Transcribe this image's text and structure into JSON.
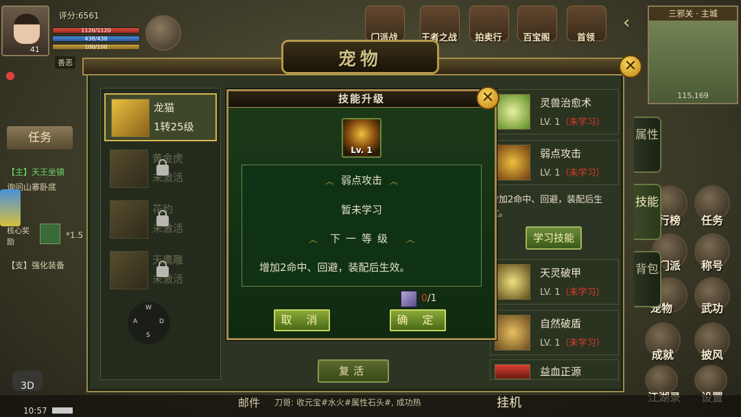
{
  "hud": {
    "score": "评分:6561",
    "level": "41",
    "hp": "1120/1120",
    "mp": "438/438",
    "sp": "100/100",
    "alignment": "善恶",
    "top_buttons": [
      "门派战",
      "王者之战",
      "拍卖行",
      "百宝阁",
      "首领"
    ],
    "minimap_title": "三邪关 · 主城",
    "minimap_coord": "115,169",
    "task_tab": "任务",
    "task_lines": [
      "【主】天王坐镇",
      "询问山寨卧底",
      "【支】强化装备"
    ],
    "reward_label": "核心奖励",
    "reward_value": "*1.5",
    "right_buttons": [
      "行榜",
      "任务",
      "门派",
      "称号",
      "宠物",
      "武功",
      "成就",
      "披风",
      "江湖录",
      "设置"
    ],
    "bottom": {
      "mail": "邮件",
      "chat": "刀哥: 收元宝#水火#属性石头#, 成功热",
      "hangup": "挂机",
      "time": "10:57",
      "mode": "3D"
    },
    "joystick": {
      "w": "W",
      "a": "A",
      "s": "S",
      "d": "D"
    }
  },
  "pet_panel": {
    "title": "宠物",
    "pets": [
      {
        "name": "龙猫",
        "sub": "1转25级",
        "locked": false
      },
      {
        "name": "黄金虎",
        "sub": "未激活",
        "locked": true
      },
      {
        "name": "花豹",
        "sub": "未激活",
        "locked": true
      },
      {
        "name": "天鹰雕",
        "sub": "未激活",
        "locked": true
      }
    ],
    "side_tabs": [
      "属性",
      "技能",
      "背包"
    ],
    "skills": [
      {
        "name": "灵兽治愈术",
        "lv": "LV. 1",
        "status": "（未学习）"
      },
      {
        "name": "弱点攻击",
        "lv": "LV. 1",
        "status": "（未学习）"
      },
      {
        "name": "天灵破甲",
        "lv": "LV. 1",
        "status": "（未学习）"
      },
      {
        "name": "自然破盾",
        "lv": "LV. 1",
        "status": "（未学习）"
      },
      {
        "name": "益血正源",
        "lv": "",
        "status": ""
      }
    ],
    "skill_desc_frag": "增加2命中、回避，装配后生效。",
    "learn_button": "学习技能",
    "revive_button": "复活"
  },
  "dialog": {
    "title": "技能升级",
    "skill_level": "Lv. 1",
    "skill_name": "弱点攻击",
    "status": "暂未学习",
    "next_level": "下一等级",
    "effect": "增加2命中、回避，装配后生效。",
    "item_have": "0",
    "item_need": "/1",
    "cancel": "取 消",
    "confirm": "确 定",
    "close": "✕"
  },
  "colors": {
    "panel_bg": "#2c3423",
    "dialog_bg": "#0f2a10",
    "gold_border": "#a88e4e",
    "button_green": "#6a8a3a",
    "unlearned_red": "#e03a2a"
  }
}
